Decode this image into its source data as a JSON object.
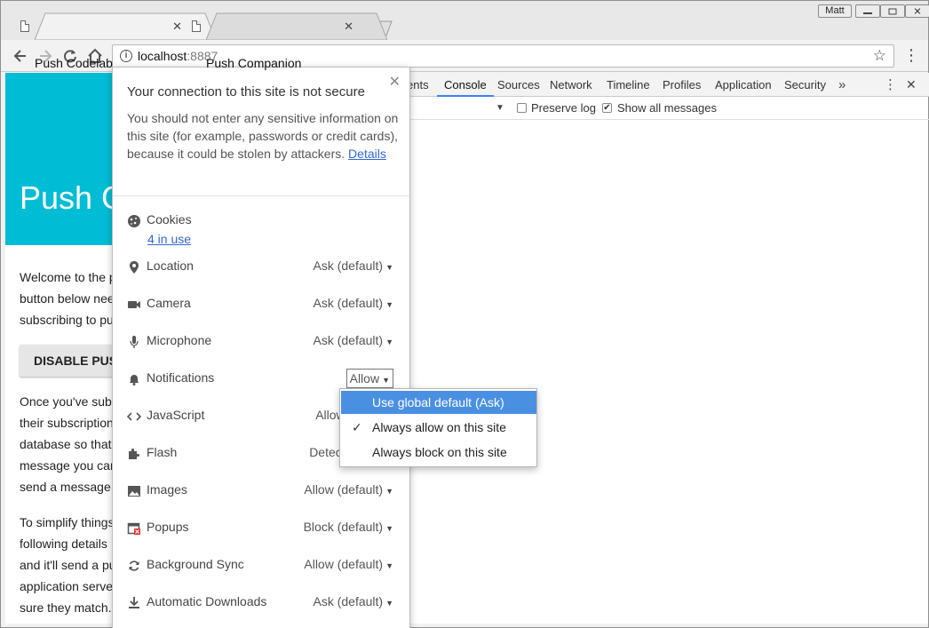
{
  "browser": {
    "tabs": [
      {
        "title": "Push Codelab",
        "close": "✕"
      },
      {
        "title": "Push Companion",
        "close": "✕"
      }
    ],
    "user_name": "Matt",
    "url_host": "localhost",
    "url_port": ":8887"
  },
  "page": {
    "heading": "Push C",
    "intro_lines": [
      "Welcome to the p",
      "button below nee",
      "subscribing to pu"
    ],
    "disable_button": "DISABLE PUSH",
    "body_lines": [
      "Once you've sub",
      "their subscription",
      "database so that",
      "message you can",
      "send a message"
    ],
    "simplify_lines": [
      "To simplify things",
      "following details",
      "and it'll send a pu",
      "application serve",
      "sure they match."
    ]
  },
  "devtools": {
    "tabs": [
      "Elements",
      "Console",
      "Sources",
      "Network",
      "Timeline",
      "Profiles",
      "Application",
      "Security"
    ],
    "tabs_visible": [
      "ents",
      "Console",
      "Sources",
      "Network",
      "Timeline",
      "Profiles",
      "Application",
      "Security"
    ],
    "active_tab": "Console",
    "overflow": "»",
    "more_icon": "⋮",
    "close_icon": "✕",
    "preserve_log": "Preserve log",
    "show_all_messages": "Show all messages"
  },
  "site_info": {
    "title": "Your connection to this site is not secure",
    "description": "You should not enter any sensitive information on this site (for example, passwords or credit cards), because it could be stolen by attackers.",
    "details_link": "Details",
    "cookies_label": "Cookies",
    "cookies_link": "4 in use",
    "permissions": [
      {
        "label": "Location",
        "value": "Ask (default)",
        "icon": "location-pin-icon"
      },
      {
        "label": "Camera",
        "value": "Ask (default)",
        "icon": "camera-icon"
      },
      {
        "label": "Microphone",
        "value": "Ask (default)",
        "icon": "microphone-icon"
      },
      {
        "label": "Notifications",
        "value": "Allow",
        "icon": "bell-icon"
      },
      {
        "label": "JavaScript",
        "value": "Allow (d",
        "icon": "code-icon"
      },
      {
        "label": "Flash",
        "value": "Detect (d",
        "icon": "puzzle-icon"
      },
      {
        "label": "Images",
        "value": "Allow (default)",
        "icon": "image-icon"
      },
      {
        "label": "Popups",
        "value": "Block (default)",
        "icon": "popup-blocked-icon"
      },
      {
        "label": "Background Sync",
        "value": "Allow (default)",
        "icon": "sync-icon"
      },
      {
        "label": "Automatic Downloads",
        "value": "Ask (default)",
        "icon": "download-icon"
      }
    ]
  },
  "notifications_menu": {
    "items": [
      "Use global default (Ask)",
      "Always allow on this site",
      "Always block on this site"
    ],
    "highlighted_index": 0,
    "checked_index": 1
  },
  "colors": {
    "header": "#00bcd4",
    "highlight": "#4a90e2",
    "link": "#3367d6"
  }
}
